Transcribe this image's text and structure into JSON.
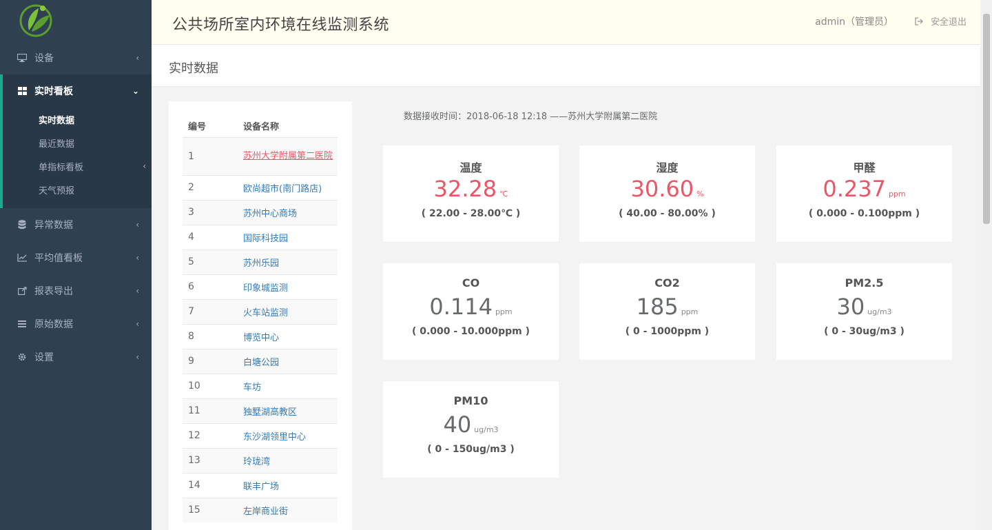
{
  "sidebar": {
    "items": [
      {
        "label": "设备",
        "icon": "monitor-icon"
      },
      {
        "label": "实时看板",
        "icon": "dashboard-icon"
      },
      {
        "label": "异常数据",
        "icon": "database-icon"
      },
      {
        "label": "平均值看板",
        "icon": "line-chart-icon"
      },
      {
        "label": "报表导出",
        "icon": "export-icon"
      },
      {
        "label": "原始数据",
        "icon": "menu-icon"
      },
      {
        "label": "设置",
        "icon": "gear-icon"
      }
    ],
    "subitems": [
      {
        "label": "实时数据"
      },
      {
        "label": "最近数据"
      },
      {
        "label": "单指标看板"
      },
      {
        "label": "天气预报"
      }
    ]
  },
  "header": {
    "title": "公共场所室内环境在线监测系统",
    "user": "admin（管理员）",
    "logout": "安全退出"
  },
  "page": {
    "title": "实时数据",
    "recv_time": "数据接收时间：2018-06-18 12:18 ——苏州大学附属第二医院"
  },
  "device_table": {
    "headers": [
      "编号",
      "设备名称"
    ],
    "rows": [
      {
        "id": "1",
        "name": "苏州大学附属第二医院"
      },
      {
        "id": "2",
        "name": "欧尚超市(南门路店)"
      },
      {
        "id": "3",
        "name": "苏州中心商场"
      },
      {
        "id": "4",
        "name": "国际科技园"
      },
      {
        "id": "5",
        "name": "苏州乐园"
      },
      {
        "id": "6",
        "name": "印象城监测"
      },
      {
        "id": "7",
        "name": "火车站监测"
      },
      {
        "id": "8",
        "name": "博览中心"
      },
      {
        "id": "9",
        "name": "白塘公园"
      },
      {
        "id": "10",
        "name": "车坊"
      },
      {
        "id": "11",
        "name": "独墅湖高教区"
      },
      {
        "id": "12",
        "name": "东沙湖领里中心"
      },
      {
        "id": "13",
        "name": "玲珑湾"
      },
      {
        "id": "14",
        "name": "联丰广场"
      },
      {
        "id": "15",
        "name": "左岸商业街"
      }
    ]
  },
  "metrics": [
    {
      "name": "温度",
      "value": "32.28",
      "unit": "℃",
      "range": "( 22.00 - 28.00℃ )"
    },
    {
      "name": "湿度",
      "value": "30.60",
      "unit": "%",
      "range": "( 40.00 - 80.00% )"
    },
    {
      "name": "甲醛",
      "value": "0.237",
      "unit": "ppm",
      "range": "( 0.000 - 0.100ppm )"
    },
    {
      "name": "CO",
      "value": "0.114",
      "unit": "ppm",
      "range": "( 0.000 - 10.000ppm )"
    },
    {
      "name": "CO2",
      "value": "185",
      "unit": "ppm",
      "range": "( 0 - 1000ppm )"
    },
    {
      "name": "PM2.5",
      "value": "30",
      "unit": "ug/m3",
      "range": "( 0 - 30ug/m3 )"
    },
    {
      "name": "PM10",
      "value": "40",
      "unit": "ug/m3",
      "range": "( 0 - 150ug/m3 )"
    }
  ],
  "colors": {
    "sidebar_bg": "#2f4050",
    "accent": "#19aa8d",
    "alarm": "#ed5565",
    "link": "#337ab7"
  }
}
